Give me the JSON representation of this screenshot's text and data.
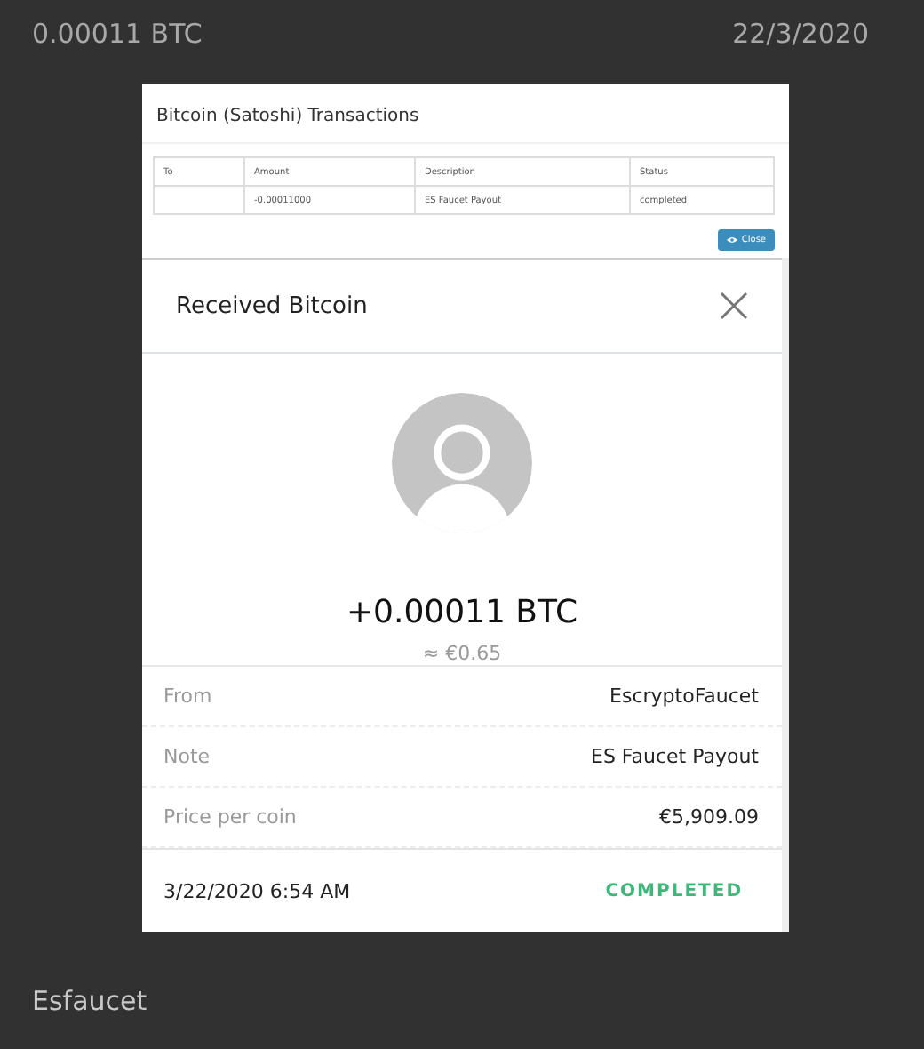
{
  "header": {
    "amount": "0.00011 BTC",
    "date": "22/3/2020"
  },
  "transactions_panel": {
    "title": "Bitcoin (Satoshi) Transactions",
    "columns": [
      "To",
      "Amount",
      "Description",
      "Status"
    ],
    "rows": [
      {
        "amount": "-0.00011000",
        "description": "ES Faucet Payout",
        "status": "completed"
      }
    ],
    "close_button": "Close"
  },
  "modal": {
    "title": "Received Bitcoin",
    "amount": "+0.00011 BTC",
    "fiat": "≈ €0.65",
    "details": [
      {
        "label": "From",
        "value": "EscryptoFaucet"
      },
      {
        "label": "Note",
        "value": "ES Faucet Payout"
      },
      {
        "label": "Price per coin",
        "value": "€5,909.09"
      }
    ],
    "timestamp": "3/22/2020 6:54 AM",
    "status": "COMPLETED"
  },
  "footer": {
    "label": "Esfaucet"
  }
}
